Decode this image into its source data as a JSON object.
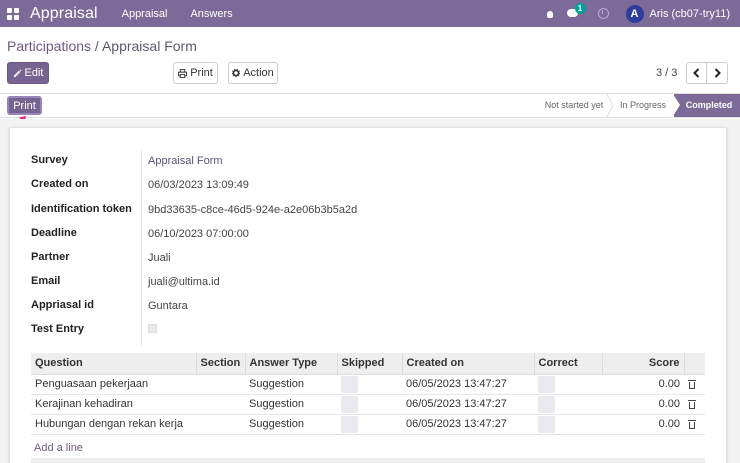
{
  "navbar": {
    "brand": "Appraisal",
    "menu": [
      "Appraisal",
      "Answers"
    ],
    "chat_badge": "1",
    "avatar_letter": "A",
    "user_name": "Aris (cb07-try11)",
    "bg_color": "#7c6a98"
  },
  "breadcrumb": {
    "parent": "Participations",
    "separator": " / ",
    "current": "Appraisal Form"
  },
  "buttons": {
    "edit": "Edit",
    "print": "Print",
    "action": "Action",
    "print_status": "Print"
  },
  "pager": {
    "value": "3 / 3",
    "prev_icon": "chevron-left-icon",
    "next_icon": "chevron-right-icon"
  },
  "status_stages": [
    {
      "label": "Not started yet",
      "active": false
    },
    {
      "label": "In Progress",
      "active": false
    },
    {
      "label": "Completed",
      "active": true
    }
  ],
  "fields": [
    {
      "label": "Survey",
      "value": "Appraisal Form",
      "link": true
    },
    {
      "label": "Created on",
      "value": "06/03/2023 13:09:49",
      "link": false
    },
    {
      "label": "Identification token",
      "value": "9bd33635-c8ce-46d5-924e-a2e06b3b5a2d",
      "link": false
    },
    {
      "label": "Deadline",
      "value": "06/10/2023 07:00:00",
      "link": false
    },
    {
      "label": "Partner",
      "value": "Juali",
      "link": false
    },
    {
      "label": "Email",
      "value": "juali@ultima.id",
      "link": false
    },
    {
      "label": "Appriasal id",
      "value": "Guntara",
      "link": false
    },
    {
      "label": "Test Entry",
      "value": "",
      "link": false
    }
  ],
  "table": {
    "columns": [
      "Question",
      "Section",
      "Answer Type",
      "Skipped",
      "Created on",
      "Correct",
      "Score"
    ],
    "rows": [
      {
        "question": "Penguasaan pekerjaan",
        "section": "",
        "answer_type": "Suggestion",
        "created_on": "06/05/2023 13:47:27",
        "score": "0.00"
      },
      {
        "question": "Kerajinan kehadiran",
        "section": "",
        "answer_type": "Suggestion",
        "created_on": "06/05/2023 13:47:27",
        "score": "0.00"
      },
      {
        "question": "Hubungan dengan rekan kerja",
        "section": "",
        "answer_type": "Suggestion",
        "created_on": "06/05/2023 13:47:27",
        "score": "0.00"
      }
    ],
    "add_line": "Add a line"
  }
}
